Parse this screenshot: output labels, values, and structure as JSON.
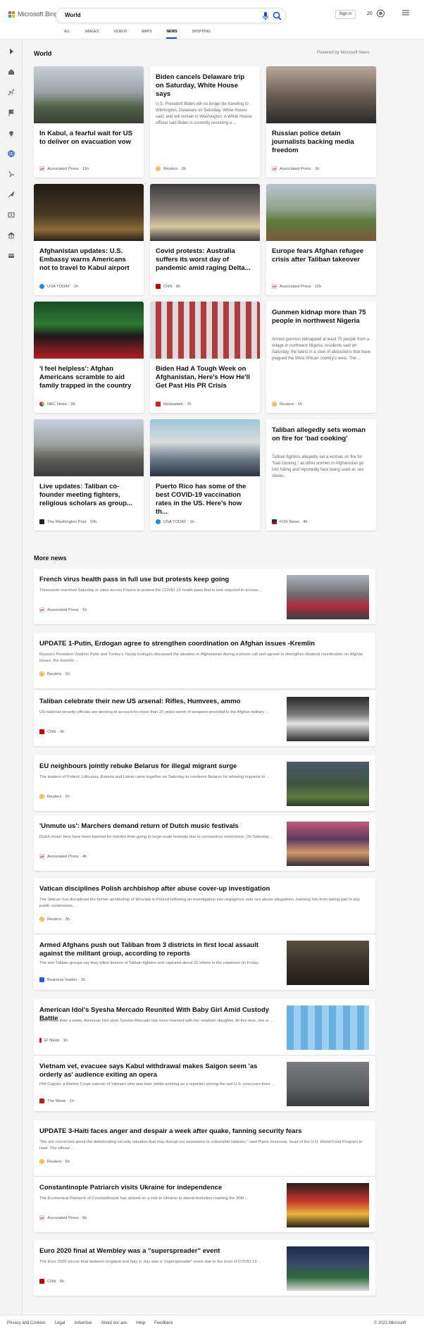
{
  "header": {
    "logo_text": "Microsoft Bing",
    "query": "World",
    "signin": "Sign in",
    "points": "20",
    "tabs": [
      "ALL",
      "IMAGES",
      "VIDEOS",
      "MAPS",
      "NEWS",
      "SHOPPING"
    ],
    "active_tab": "NEWS"
  },
  "section_title": "World",
  "powered_by": "Powered by Microsoft News",
  "cards": [
    {
      "title": "In Kabul, a fearful wait for US to deliver on evacuation vow",
      "source": "Associated Press",
      "time": "11h",
      "icon": "ap-icon",
      "color": "#c0c0c0"
    },
    {
      "title": "Biden cancels Delaware trip on Saturday, White House says",
      "snippet": "U.S. President Biden will no longer be traveling to Wilmington, Delaware on Saturday, White House said, and will remain in Washington. A White House official said Biden is currently receiving a ...",
      "source": "Reuters",
      "time": "3h",
      "icon": "reuters-icon"
    },
    {
      "title": "Russian police detain journalists backing media freedom",
      "source": "Associated Press",
      "time": "1h",
      "icon": "ap-icon"
    },
    {
      "title": "Afghanistan updates: U.S. Embassy warns Americans not to travel to Kabul airport",
      "source": "USA TODAY",
      "time": "1h",
      "icon": "usatoday-icon"
    },
    {
      "title": "Covid protests: Australia suffers its worst day of pandemic amid raging Delta...",
      "source": "CNN",
      "time": "8h",
      "icon": "cnn-icon"
    },
    {
      "title": "Europe fears Afghan refugee crisis after Taliban takeover",
      "source": "Associated Press",
      "time": "11h",
      "icon": "ap-icon"
    },
    {
      "title": "'I feel helpless': Afghan Americans scramble to aid family trapped in the country",
      "source": "NBC News",
      "time": "9h",
      "icon": "nbc-icon"
    },
    {
      "title": "Biden Had A Tough Week on Afghanistan, Here's How He'll Get Past His PR Crisis",
      "source": "Newsweek",
      "time": "7h",
      "icon": "newsweek-icon"
    },
    {
      "title": "Gunmen kidnap more than 75 people in northwest Nigeria",
      "snippet": "Armed gunmen kidnapped at least 75 people from a village in northwest Nigeria, residents said on Saturday, the latest in a slew of abductions that have plagued the West African country's west. The ...",
      "source": "Reuters",
      "time": "1h",
      "icon": "reuters-icon"
    },
    {
      "title": "Live updates: Taliban co-founder meeting fighters, religious scholars as group...",
      "source": "The Washington Post",
      "time": "10h",
      "icon": "wapo-icon"
    },
    {
      "title": "Puerto Rico has some of the best COVID-19 vaccination rates in the US. Here's how th...",
      "source": "USA TODAY",
      "time": "1h",
      "icon": "usatoday-icon"
    },
    {
      "title": "Taliban allegedly sets woman on fire for 'bad cooking'",
      "snippet": "Taliban fighters allegedly set a woman on fire for \"bad cooking,\" as other women in Afghanistan go into hiding and reportedly face being used as sex slaves.",
      "source": "FOX News",
      "time": "4h",
      "icon": "fox-icon"
    }
  ],
  "more_news_title": "More news",
  "more_news": [
    {
      "title": "French virus health pass in full use but protests keep going",
      "snippet": "Thousands marched Saturday in cities across France to protest the COVID-19 health pass that is now required to access ...",
      "source": "Associated Press",
      "time": "1h",
      "icon": "ap-icon"
    },
    {
      "title": "UPDATE 1-Putin, Erdogan agree to strengthen coordination on Afghan issues -Kremlin",
      "snippet": "Russia's President Vladimir Putin and Turkey's Tayyip Erdogan discussed the situation in Afghanistan during a phone call and agreed to strengthen bilateral coordination on Afghan issues, the Kremlin ...",
      "source": "Reuters",
      "time": "2h",
      "icon": "reuters-icon"
    },
    {
      "title": "Taliban celebrate their new US arsenal: Rifles, Humvees, ammo",
      "snippet": "US national security officials are working to account for more than 20 years worth of weapons provided to the Afghan military ...",
      "source": "CNN",
      "time": "3h",
      "icon": "cnn-icon"
    },
    {
      "title": "EU neighbours jointly rebuke Belarus for illegal migrant surge",
      "snippet": "The leaders of Poland, Lithuania, Estonia and Latvia came together on Saturday to condemn Belarus for allowing migrants to ...",
      "source": "Reuters",
      "time": "2h",
      "icon": "reuters-icon"
    },
    {
      "title": "'Unmute us': Marchers demand return of Dutch music festivals",
      "snippet": "Dutch music fans have been banned for months from going to large-scale festivals due to coronavirus restrictions. On Saturday ...",
      "source": "Associated Press",
      "time": "4h",
      "icon": "ap-icon"
    },
    {
      "title": "Vatican disciplines Polish archbishop after abuse cover-up investigation",
      "snippet": "The Vatican has disciplined the former archbishop of Wroclaw in Poland following an investigation into negligence over sex abuse allegations, banning him from taking part in any public ceremonies, ...",
      "source": "Reuters",
      "time": "3h",
      "icon": "reuters-icon"
    },
    {
      "title": "Armed Afghans push out Taliban from 3 districts in first local assault against the militant group, according to reports",
      "snippet": "The anti-Taliban groups say they killed dozens of Taliban fighters and captured about 20 others in the expulsion on Friday.",
      "source": "Business Insider",
      "time": "1h",
      "icon": "bi-icon"
    },
    {
      "title": "American Idol's Syesha Mercado Reunited With Baby Girl Amid Custody Battle",
      "snippet": "After more than a week, American Idol alum Syesha Mercado has been reunited with her newborn daughter. At this time, she is ...",
      "source": "E! News",
      "time": "1h",
      "icon": "enews-icon"
    },
    {
      "title": "Vietnam vet, evacuee says Kabul withdrawal makes Saigon seem 'as orderly as' audience exiting an opera",
      "snippet": "Phil Caputo, a Marine Corps veteran of Vietnam who was later (while working as a reporter) among the last U.S. evacuees from ...",
      "source": "The Week",
      "time": "1h",
      "icon": "theweek-icon"
    },
    {
      "title": "UPDATE 3-Haiti faces anger and despair a week after quake, fanning security fears",
      "snippet": "\"We are concerned about the deteriorating security situation that may disrupt our assistance to vulnerable Haitians,\" said Pierre Honnorat, head of the U.N. World Food Program in Haiti. The official ...",
      "source": "Reuters",
      "time": "5h",
      "icon": "reuters-icon"
    },
    {
      "title": "Constantinople Patriarch visits Ukraine for independence",
      "snippet": "The Ecumenical Patriarch of Constantinople has arrived on a visit to Ukraine to attend festivities marking the 30th ...",
      "source": "Associated Press",
      "time": "5h",
      "icon": "ap-icon"
    },
    {
      "title": "Euro 2020 final at Wembley was a \"superspreader\" event",
      "snippet": "The Euro 2020 soccer final between England and Italy in July was a \"superspreader\" event due to the level of COVID-19 ...",
      "source": "CNN",
      "time": "6h",
      "icon": "cnn-icon"
    }
  ],
  "footer": {
    "links": [
      "Privacy and Cookies",
      "Legal",
      "Advertise",
      "About our ads",
      "Help",
      "Feedback"
    ],
    "copyright": "© 2021 Microsoft"
  }
}
